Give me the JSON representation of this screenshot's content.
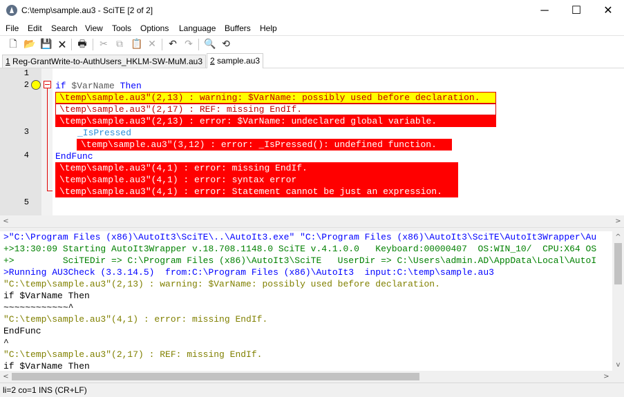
{
  "window": {
    "title": "C:\\temp\\sample.au3 - SciTE [2 of 2]",
    "minimize_glyph": "─",
    "maximize_glyph": "☐",
    "close_glyph": "✕"
  },
  "menu": [
    "File",
    "Edit",
    "Search",
    "View",
    "Tools",
    "Options",
    "Language",
    "Buffers",
    "Help"
  ],
  "toolbar": {
    "icons": [
      "new-file-icon",
      "open-folder-icon",
      "save-icon",
      "close-file-icon",
      "print-icon",
      "cut-icon",
      "copy-icon",
      "paste-icon",
      "delete-icon",
      "undo-icon",
      "redo-icon",
      "find-icon",
      "replace-icon"
    ],
    "glyphs": {
      "new": "🗋",
      "open": "📂",
      "save": "💾",
      "close": "🗙",
      "print": "🖶",
      "cut": "✂",
      "copy": "⧉",
      "paste": "📋",
      "delete": "✕",
      "undo": "↶",
      "redo": "↷",
      "find": "🔍",
      "replace": "⟲"
    }
  },
  "tabs": [
    {
      "number": "1",
      "label": "Reg-GrantWrite-to-AuthUsers_HKLM-SW-MuM.au3",
      "active": false
    },
    {
      "number": "2",
      "label": "sample.au3",
      "active": true
    }
  ],
  "editor": {
    "line_numbers": [
      "1",
      "2",
      "3",
      "4",
      "5"
    ],
    "code": {
      "line2_kw1": "if",
      "line2_var": "$VarName",
      "line2_kw2": "Then",
      "line3_fn": "_IsPressed",
      "line4_kw": "EndFunc"
    },
    "annotations": {
      "line2": [
        "\\temp\\sample.au3\"(2,13) : warning: $VarName: possibly used before declaration.",
        "\\temp\\sample.au3\"(2,17) : REF: missing EndIf.",
        "\\temp\\sample.au3\"(2,13) : error: $VarName: undeclared global variable."
      ],
      "line3": [
        "\\temp\\sample.au3\"(3,12) : error: _IsPressed(): undefined function."
      ],
      "line4": [
        "\\temp\\sample.au3\"(4,1) : error: missing EndIf.",
        "\\temp\\sample.au3\"(4,1) : error: syntax error",
        "\\temp\\sample.au3\"(4,1) : error: Statement cannot be just an expression."
      ]
    }
  },
  "output": {
    "lines": [
      {
        "text": ">\"C:\\Program Files (x86)\\AutoIt3\\SciTE\\..\\AutoIt3.exe\" \"C:\\Program Files (x86)\\AutoIt3\\SciTE\\AutoIt3Wrapper\\Au",
        "color": "blue"
      },
      {
        "text": "+>13:30:09 Starting AutoIt3Wrapper v.18.708.1148.0 SciTE v.4.1.0.0   Keyboard:00000407  OS:WIN_10/  CPU:X64 OS",
        "color": "green"
      },
      {
        "text": "+>         SciTEDir => C:\\Program Files (x86)\\AutoIt3\\SciTE   UserDir => C:\\Users\\admin.AD\\AppData\\Local\\AutoI",
        "color": "green"
      },
      {
        "text": ">Running AU3Check (3.3.14.5)  from:C:\\Program Files (x86)\\AutoIt3  input:C:\\temp\\sample.au3",
        "color": "blue"
      },
      {
        "text": "\"C:\\temp\\sample.au3\"(2,13) : warning: $VarName: possibly used before declaration.",
        "color": "olive"
      },
      {
        "text": "if $VarName Then",
        "color": "black"
      },
      {
        "text": "~~~~~~~~~~~~^",
        "color": "black"
      },
      {
        "text": "\"C:\\temp\\sample.au3\"(4,1) : error: missing EndIf.",
        "color": "olive"
      },
      {
        "text": "EndFunc",
        "color": "black"
      },
      {
        "text": "^",
        "color": "black"
      },
      {
        "text": "\"C:\\temp\\sample.au3\"(2,17) : REF: missing EndIf.",
        "color": "olive"
      },
      {
        "text": "if $VarName Then",
        "color": "black"
      }
    ]
  },
  "scroll": {
    "left_arrow": "<",
    "right_arrow": ">",
    "up_arrow": "^",
    "down_arrow": "v"
  },
  "status": {
    "text": "li=2 co=1 INS (CR+LF)"
  }
}
